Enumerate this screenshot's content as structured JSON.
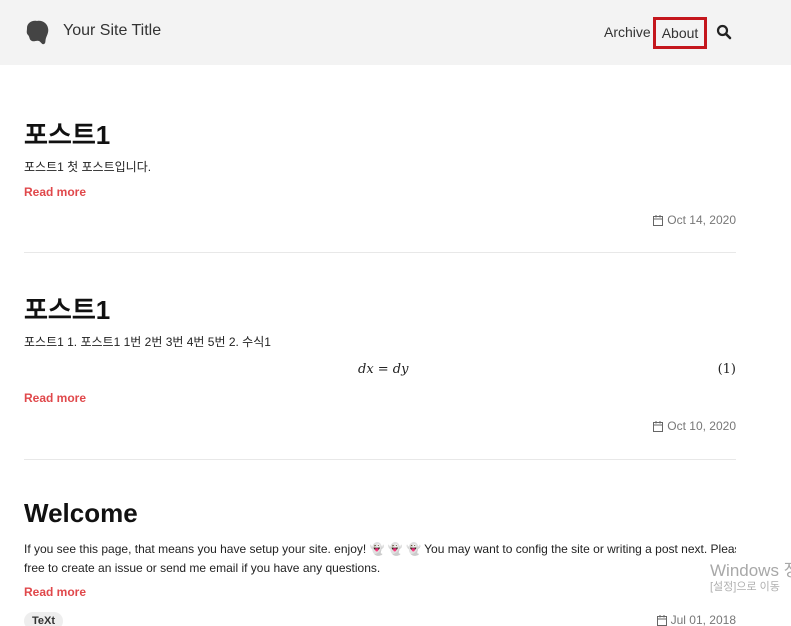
{
  "header": {
    "site_title": "Your Site Title",
    "nav": [
      "Archive",
      "About"
    ],
    "icons": {
      "logo": "logo-icon",
      "search": "search-icon"
    }
  },
  "posts": [
    {
      "title": "포스트1",
      "summary": "포스트1 첫 포스트입니다.",
      "read_more": "Read more",
      "date": "Oct 14, 2020"
    },
    {
      "title": "포스트1",
      "summary": "포스트1 1. 포스트1 1번 2번 3번 4번 5번 2. 수식1",
      "formula": "dx = dy",
      "formula_number": "(1)",
      "read_more": "Read more",
      "date": "Oct 10, 2020"
    },
    {
      "title": "Welcome",
      "summary_line1": "If you see this page, that means you have setup your site. enjoy! 👻 👻 👻 You may want to config the site or writing a post next. Please feel",
      "summary_line2": "free to create an issue or send me email if you have any questions.",
      "read_more": "Read more",
      "tag": "TeXt",
      "date": "Jul 01, 2018"
    }
  ],
  "watermark": {
    "line1": "Windows 정",
    "line2": "[설정]으로 이동"
  },
  "colors": {
    "accent": "#e0484b",
    "highlight_box": "#c4161c",
    "header_bg": "#f3f3f3"
  }
}
